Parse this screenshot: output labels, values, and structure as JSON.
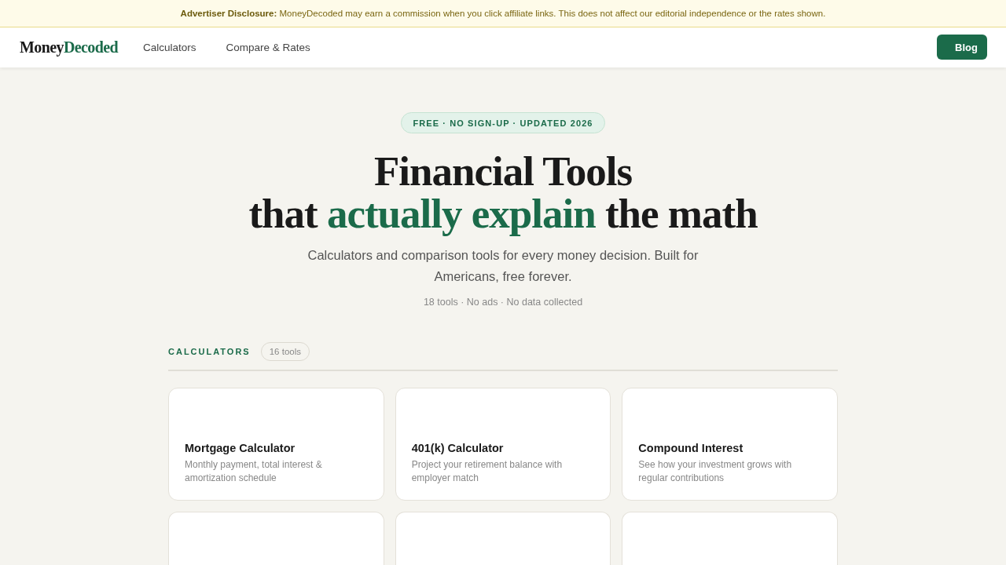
{
  "disclosure": {
    "text": "**Advertiser Disclosure:** MoneyDecoded may earn a commission when you click affiliate links. This does not affect our editorial independence or the rates shown."
  },
  "nav": {
    "logo": {
      "dark": "Money",
      "accent": "Decoded"
    },
    "links": [
      "Calculators",
      "Compare & Rates"
    ],
    "button": "Blog"
  },
  "hero": {
    "badge": "FREE · NO SIGN-UP · UPDATED 2026",
    "headline": {
      "line_1": "Financial Tools",
      "line_2_start": "that",
      "highlight": "actually explain",
      "line_2_end": "the math"
    },
    "subtitle": "Calculators and comparison tools for every money decision. Built for Americans, free forever.",
    "meta": "18 tools · No ads · No data collected"
  },
  "section": {
    "title": "CALCULATORS",
    "count": "16 tools",
    "cards": [
      {
        "kind": "tool",
        "title": "Mortgage Calculator",
        "description": "Monthly payment, total interest & amortization schedule"
      },
      {
        "kind": "tool",
        "title": "401(k) Calculator",
        "description": "Project your retirement balance with employer match"
      },
      {
        "kind": "tool",
        "title": "Compound Interest",
        "description": "See how your investment grows with regular contributions"
      },
      {
        "kind": "cut_off"
      },
      {
        "kind": "cut_off"
      },
      {
        "kind": "cut_off"
      }
    ]
  }
}
